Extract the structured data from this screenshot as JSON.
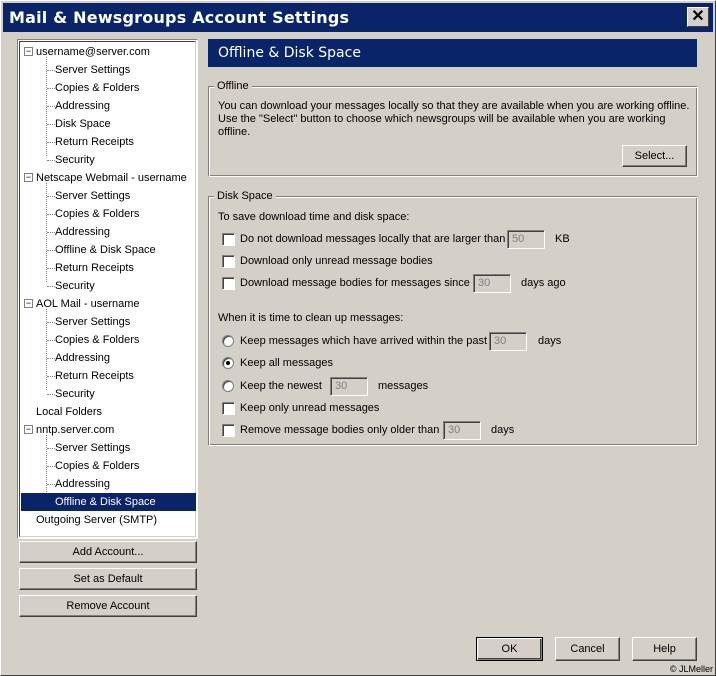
{
  "window": {
    "title": "Mail & Newsgroups Account Settings",
    "close_glyph": "✕"
  },
  "tree": {
    "accounts": [
      {
        "label": "username@server.com",
        "children": [
          "Server Settings",
          "Copies & Folders",
          "Addressing",
          "Disk Space",
          "Return Receipts",
          "Security"
        ]
      },
      {
        "label": "Netscape Webmail - username",
        "children": [
          "Server Settings",
          "Copies & Folders",
          "Addressing",
          "Offline & Disk Space",
          "Return Receipts",
          "Security"
        ]
      },
      {
        "label": "AOL Mail - username",
        "children": [
          "Server Settings",
          "Copies & Folders",
          "Addressing",
          "Return Receipts",
          "Security"
        ]
      },
      {
        "label": "Local Folders",
        "children": []
      },
      {
        "label": "nntp.server.com",
        "children": [
          "Server Settings",
          "Copies & Folders",
          "Addressing",
          "Offline & Disk Space"
        ]
      },
      {
        "label": "Outgoing Server (SMTP)",
        "children": []
      }
    ],
    "toggle_glyph": "−",
    "selected": "Offline & Disk Space"
  },
  "left_buttons": {
    "add": "Add Account...",
    "default": "Set as Default",
    "remove": "Remove Account"
  },
  "panel": {
    "title": "Offline & Disk Space",
    "offline": {
      "label": "Offline",
      "desc1": "You can download your messages locally so that they are available when you are working offline.",
      "desc2": "Use the \"Select\" button to choose which newsgroups will be available when you are working",
      "desc3": "offline.",
      "select_btn": "Select..."
    },
    "disk": {
      "label": "Disk Space",
      "save_intro": "To save download time and disk space:",
      "opt1": "Do not download messages locally that are larger than",
      "opt1_value": "50",
      "opt1_unit": "KB",
      "opt2": "Download only unread message bodies",
      "opt3": "Download message bodies for messages since",
      "opt3_value": "30",
      "opt3_unit": "days ago",
      "cleanup_intro": "When it is time to clean up messages:",
      "r1": "Keep messages which have arrived within the past",
      "r1_value": "30",
      "r1_unit": "days",
      "r2": "Keep all messages",
      "r3": "Keep the newest",
      "r3_value": "30",
      "r3_unit": "messages",
      "c1": "Keep only unread messages",
      "c2": "Remove message bodies only older than",
      "c2_value": "30",
      "c2_unit": "days"
    }
  },
  "footer": {
    "ok": "OK",
    "cancel": "Cancel",
    "help": "Help",
    "copyright": "© JLMeller"
  }
}
